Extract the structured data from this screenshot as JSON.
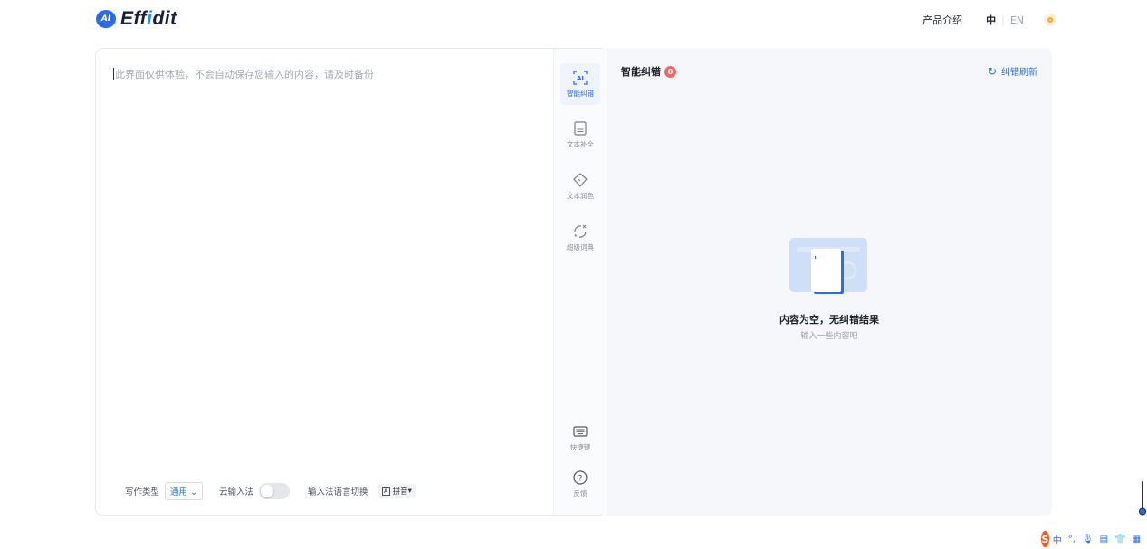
{
  "header": {
    "logo_badge": "AI",
    "logo_text_pre": "Eff",
    "logo_text_i": "i",
    "logo_text_post": "dit",
    "nav_product": "产品介绍",
    "lang_zh": "中",
    "lang_sep": "|",
    "lang_en": "EN"
  },
  "editor": {
    "placeholder": "此界面仅供体验，不会自动保存您输入的内容，请及时备份",
    "footer": {
      "writing_type_label": "写作类型",
      "writing_type_value": "通用",
      "cloud_ime_label": "云输入法",
      "cloud_ime_on": false,
      "ime_switch_label": "输入法语言切换",
      "ime_box": "Ä",
      "ime_value": "拼音"
    }
  },
  "tools": [
    {
      "label": "智能纠错",
      "icon": "ai-correct-icon",
      "active": true
    },
    {
      "label": "文本补全",
      "icon": "document-icon",
      "active": false
    },
    {
      "label": "文本润色",
      "icon": "polish-icon",
      "active": false
    },
    {
      "label": "超级词典",
      "icon": "dictionary-icon",
      "active": false
    },
    {
      "label": "快捷键",
      "icon": "keyboard-icon",
      "active": false
    },
    {
      "label": "反馈",
      "icon": "help-icon",
      "active": false
    }
  ],
  "panel": {
    "title": "智能纠错",
    "count": "0",
    "refresh_icon": "↻",
    "refresh_label": "纠错刷新",
    "empty_title": "内容为空，无纠错结果",
    "empty_sub": "输入一些内容吧"
  },
  "ime_bar": {
    "logo": "S",
    "mode": "中",
    "punct": "°,",
    "mic": "🎙",
    "kbd": "▤",
    "skin": "👕",
    "tools": "▦"
  },
  "colors": {
    "accent": "#2b6de5",
    "badge": "#ee6a6a",
    "panel_bg": "#f5f7fa"
  }
}
